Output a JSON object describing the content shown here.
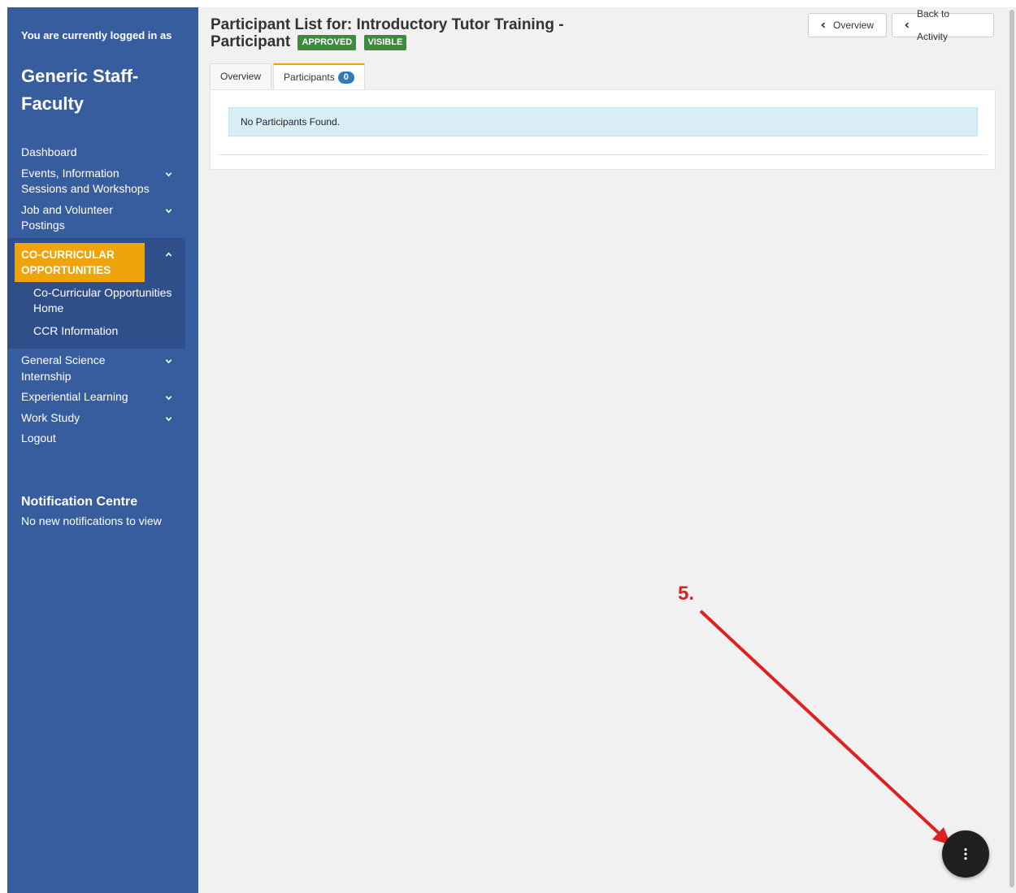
{
  "sidebar": {
    "login_label": "You are currently logged in as",
    "user_name": "Generic Staff-Faculty",
    "nav": {
      "dashboard": "Dashboard",
      "events": "Events, Information Sessions and Workshops",
      "jobs": "Job and Volunteer Postings",
      "cocurricular": "CO-CURRICULAR OPPORTUNITIES",
      "cocurricular_home": "Co-Curricular Opportunities Home",
      "ccr_info": "CCR Information",
      "gen_sci": "General Science Internship",
      "experiential": "Experiential Learning",
      "work_study": "Work Study",
      "logout": "Logout"
    },
    "notification": {
      "title": "Notification Centre",
      "text": "No new notifications to view"
    }
  },
  "header": {
    "title": "Participant List for: Introductory Tutor Training - Participant",
    "badge_approved": "APPROVED",
    "badge_visible": "VISIBLE",
    "btn_overview": "Overview",
    "btn_back": "Back to Activity"
  },
  "tabs": {
    "overview": "Overview",
    "participants": "Participants",
    "participants_count": "0"
  },
  "alert": {
    "text": "No Participants Found."
  },
  "annotation": {
    "label": "5."
  },
  "colors": {
    "sidebar_bg": "#385d9e",
    "active_nav": "#f0a30a",
    "badge_green": "#3d8b3d",
    "alert_bg": "#d9edf7",
    "annotation_red": "#e02020",
    "fab_bg": "#1f1f1f"
  },
  "icons": {
    "nav_chevron": "chevron-down-icon",
    "nav_chevron_open": "chevron-up-icon",
    "button_chevron": "chevron-left-icon",
    "fab": "vertical-dots-icon"
  }
}
